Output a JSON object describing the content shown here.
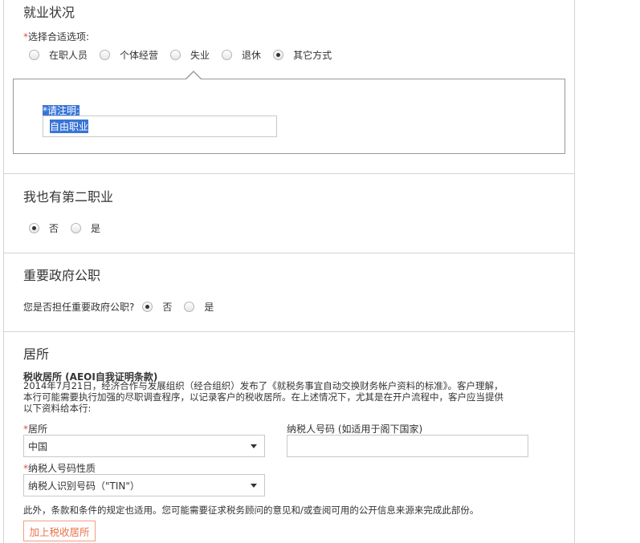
{
  "employment": {
    "title": "就业状况",
    "prompt_req": "*",
    "prompt": "选择合适选项:",
    "options": [
      "在职人员",
      "个体经营",
      "失业",
      "退休",
      "其它方式"
    ],
    "selected": "其它方式",
    "detail_label": "*请注明:",
    "detail_value": "自由职业"
  },
  "second_job": {
    "title": "我也有第二职业",
    "options": [
      "否",
      "是"
    ],
    "selected": "否"
  },
  "pep": {
    "title": "重要政府公职",
    "question": "您是否担任重要政府公职?",
    "options": [
      "否",
      "是"
    ],
    "selected": "否"
  },
  "residence": {
    "title": "居所",
    "subtitle": "税收居所 (AEOI自我证明条款)",
    "paragraph": "2014年7月21日，经济合作与发展组织（经合组织）发布了《就税务事宜自动交换财务帐户资料的标准》。客户理解，本行可能需要执行加强的尽职调查程序，以记录客户的税收居所。在上述情况下，尤其是在开户流程中，客户应当提供以下资料给本行:",
    "residence_req": "*",
    "residence_label": "居所",
    "residence_value": "中国",
    "tin_label": "纳税人号码 (如适用于阁下国家)",
    "tin_value": "",
    "tin_type_req": "*",
    "tin_type_label": "纳税人号码性质",
    "tin_type_value": "纳税人识别号码（\"TIN\"）",
    "note": "此外，条款和条件的规定也适用。您可能需要征求税务顾问的意见和/或查阅可用的公开信息来源来完成此部份。",
    "add_button": "加上税收居所"
  }
}
